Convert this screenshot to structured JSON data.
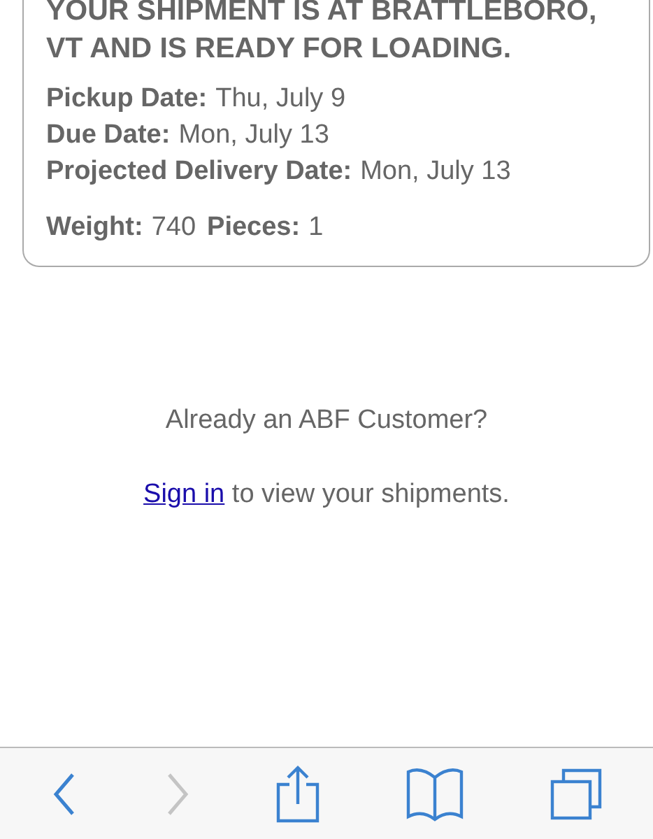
{
  "status_card": {
    "headline": "YOUR SHIPMENT IS AT BRATTLEBORO, VT AND IS READY FOR LOADING.",
    "dates": [
      {
        "label": "Pickup Date:",
        "value": "Thu, July 9"
      },
      {
        "label": "Due Date:",
        "value": "Mon, July 13"
      },
      {
        "label": "Projected Delivery Date:",
        "value": "Mon, July 13"
      }
    ],
    "totals": [
      {
        "label": "Weight:",
        "value": "740"
      },
      {
        "label": "Pieces:",
        "value": "1"
      }
    ]
  },
  "prompt": "Already an ABF Customer?",
  "sign_in": {
    "link": "Sign in",
    "text": " to view your shipments."
  },
  "toolbar": [
    {
      "kind": "back",
      "disabled": false
    },
    {
      "kind": "forward",
      "disabled": true
    },
    {
      "kind": "share",
      "disabled": false
    },
    {
      "kind": "bookmarks",
      "disabled": false
    },
    {
      "kind": "tabs",
      "disabled": false
    }
  ]
}
